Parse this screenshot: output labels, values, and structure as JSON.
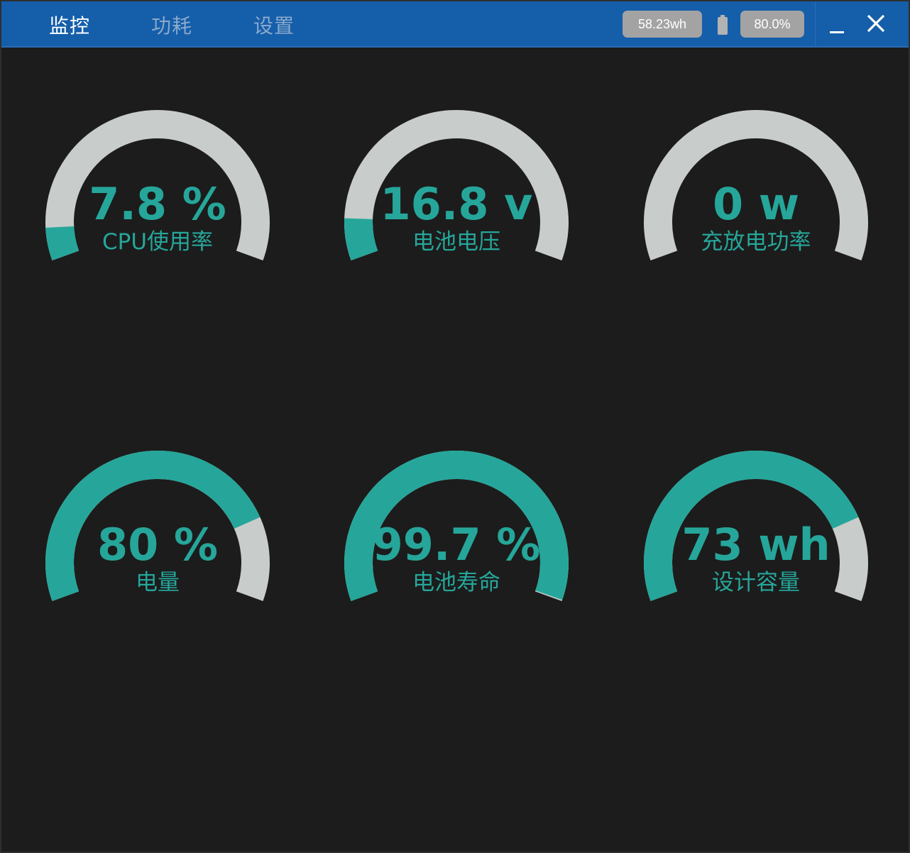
{
  "tabs": [
    {
      "label": "监控",
      "active": true
    },
    {
      "label": "功耗",
      "active": false
    },
    {
      "label": "设置",
      "active": false
    }
  ],
  "status": {
    "energy": "58.23wh",
    "battery_percent": "80.0%",
    "battery_icon": "battery-icon"
  },
  "window_controls": {
    "minimize_icon": "minimize-icon",
    "close_icon": "close-icon"
  },
  "colors": {
    "titlebar": "#155eaa",
    "background": "#1c1c1c",
    "accent": "#26a69a",
    "track": "#c8cccb",
    "pill": "#a3a3a3"
  },
  "gauges": [
    {
      "value": "7.8 %",
      "label": "CPU使用率",
      "fraction": 0.078
    },
    {
      "value": "16.8 v",
      "label": "电池电压",
      "fraction": 0.1
    },
    {
      "value": "0 w",
      "label": "充放电功率",
      "fraction": 0.0
    },
    {
      "value": "80 %",
      "label": "电量",
      "fraction": 0.8
    },
    {
      "value": "99.7 %",
      "label": "电池寿命",
      "fraction": 0.997
    },
    {
      "value": "73 wh",
      "label": "设计容量",
      "fraction": 0.8
    }
  ]
}
